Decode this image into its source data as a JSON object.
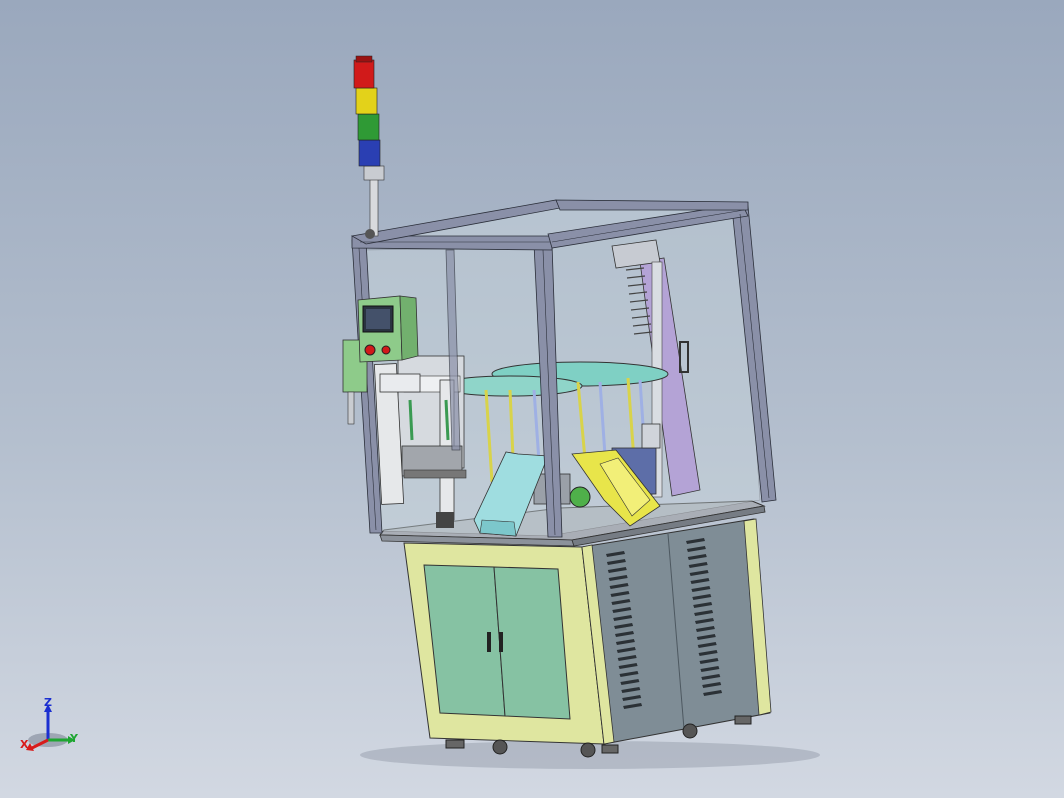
{
  "triad": {
    "x_label": "X",
    "y_label": "Y",
    "z_label": "Z"
  },
  "colors": {
    "background_top": "#9aa8bd",
    "background_bottom": "#d2d8e2",
    "cabinet_frame": "#dfe6a0",
    "cabinet_doors": "#86c2a3",
    "cabinet_side": "#7f8d96",
    "profile": "#8a90a8",
    "glass": "#c9d6dc",
    "chute_yellow": "#e8e54a",
    "chute_cyan": "#9fdde0",
    "plate_teal": "#7fd0c4",
    "column_violet": "#b4a3d6",
    "tower_red": "#d11a1a",
    "tower_yellow": "#e3d21a",
    "tower_green": "#2f9a35",
    "tower_blue": "#2a3fb3"
  },
  "signal_tower": [
    "red",
    "yellow",
    "green",
    "blue"
  ]
}
